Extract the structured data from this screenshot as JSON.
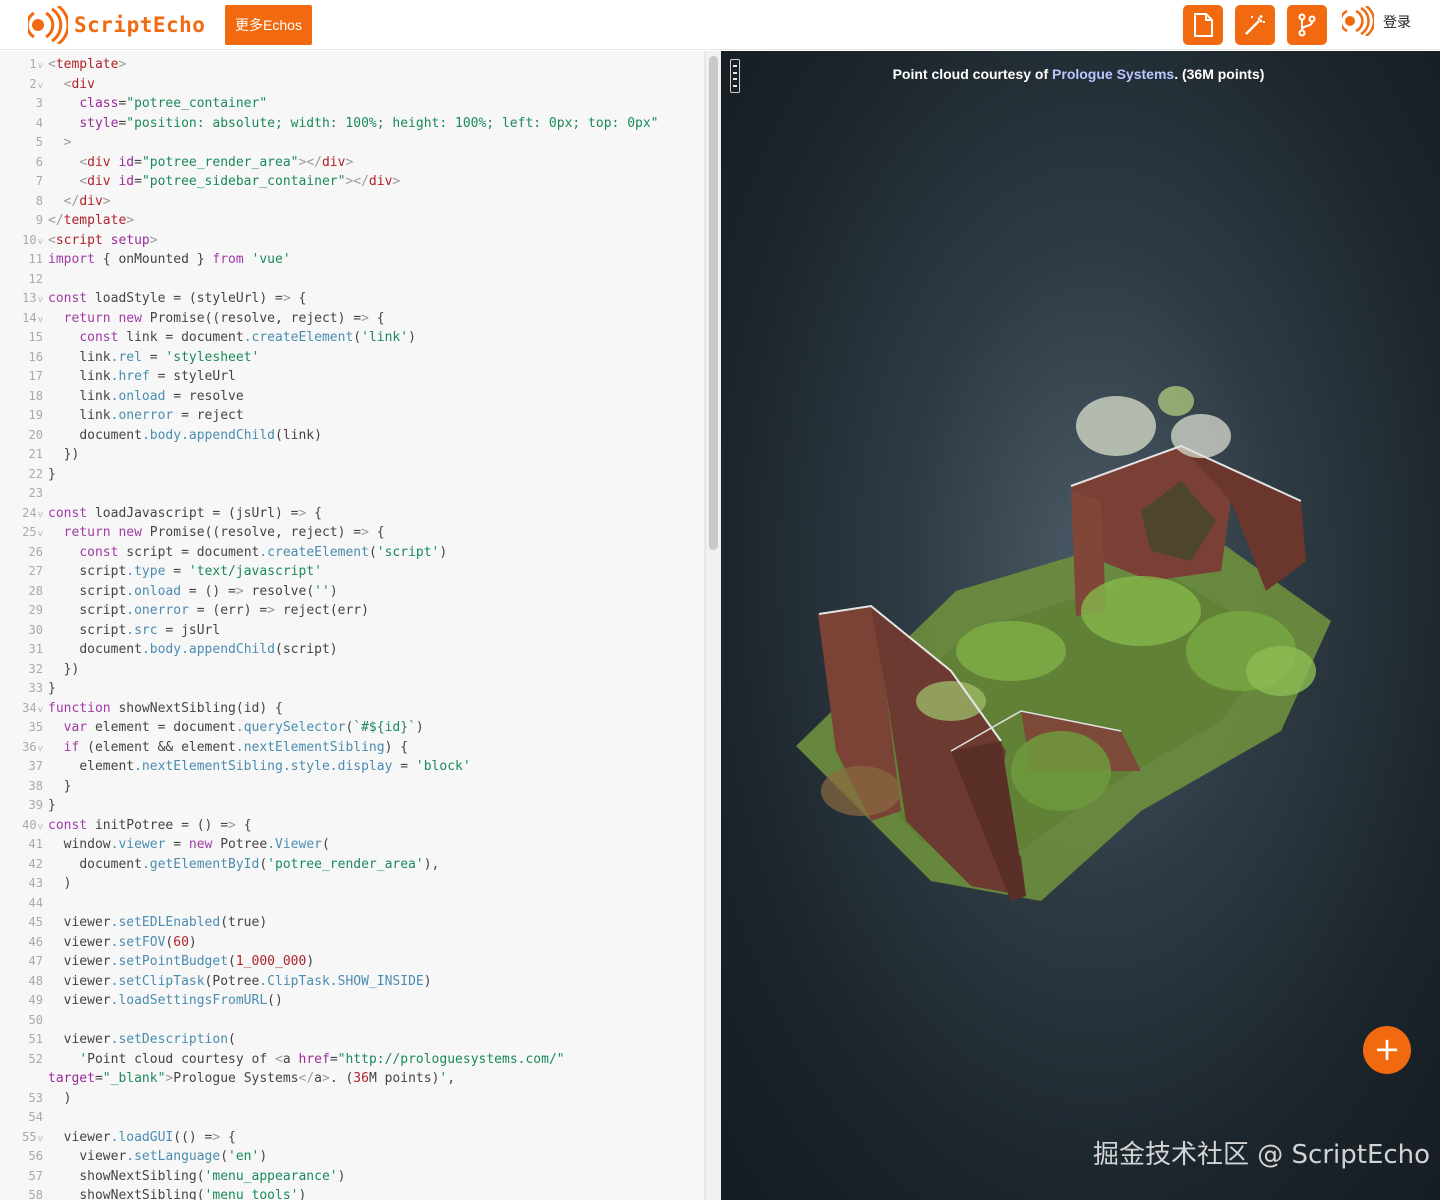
{
  "header": {
    "logo_text": "ScriptEcho",
    "more_button": "更多Echos",
    "login_label": "登录",
    "icons": [
      "file-icon",
      "magic-wand-icon",
      "fork-icon"
    ]
  },
  "colors": {
    "accent": "#f26a10",
    "viewer_bg": "#1f2a31",
    "link": "#b9c7ff"
  },
  "editor": {
    "lines": [
      {
        "n": "1",
        "fold": true,
        "text": "<template>"
      },
      {
        "n": "2",
        "fold": true,
        "text": "  <div"
      },
      {
        "n": "3",
        "fold": false,
        "text": "    class=\"potree_container\""
      },
      {
        "n": "4",
        "fold": false,
        "text": "    style=\"position: absolute; width: 100%; height: 100%; left: 0px; top: 0px\""
      },
      {
        "n": "5",
        "fold": false,
        "text": "  >"
      },
      {
        "n": "6",
        "fold": false,
        "text": "    <div id=\"potree_render_area\"></div>"
      },
      {
        "n": "7",
        "fold": false,
        "text": "    <div id=\"potree_sidebar_container\"></div>"
      },
      {
        "n": "8",
        "fold": false,
        "text": "  </div>"
      },
      {
        "n": "9",
        "fold": false,
        "text": "</template>"
      },
      {
        "n": "10",
        "fold": true,
        "text": "<script setup>"
      },
      {
        "n": "11",
        "fold": false,
        "text": "import { onMounted } from 'vue'"
      },
      {
        "n": "12",
        "fold": false,
        "text": ""
      },
      {
        "n": "13",
        "fold": true,
        "text": "const loadStyle = (styleUrl) => {"
      },
      {
        "n": "14",
        "fold": true,
        "text": "  return new Promise((resolve, reject) => {"
      },
      {
        "n": "15",
        "fold": false,
        "text": "    const link = document.createElement('link')"
      },
      {
        "n": "16",
        "fold": false,
        "text": "    link.rel = 'stylesheet'"
      },
      {
        "n": "17",
        "fold": false,
        "text": "    link.href = styleUrl"
      },
      {
        "n": "18",
        "fold": false,
        "text": "    link.onload = resolve"
      },
      {
        "n": "19",
        "fold": false,
        "text": "    link.onerror = reject"
      },
      {
        "n": "20",
        "fold": false,
        "text": "    document.body.appendChild(link)"
      },
      {
        "n": "21",
        "fold": false,
        "text": "  })"
      },
      {
        "n": "22",
        "fold": false,
        "text": "}"
      },
      {
        "n": "23",
        "fold": false,
        "text": ""
      },
      {
        "n": "24",
        "fold": true,
        "text": "const loadJavascript = (jsUrl) => {"
      },
      {
        "n": "25",
        "fold": true,
        "text": "  return new Promise((resolve, reject) => {"
      },
      {
        "n": "26",
        "fold": false,
        "text": "    const script = document.createElement('script')"
      },
      {
        "n": "27",
        "fold": false,
        "text": "    script.type = 'text/javascript'"
      },
      {
        "n": "28",
        "fold": false,
        "text": "    script.onload = () => resolve('')"
      },
      {
        "n": "29",
        "fold": false,
        "text": "    script.onerror = (err) => reject(err)"
      },
      {
        "n": "30",
        "fold": false,
        "text": "    script.src = jsUrl"
      },
      {
        "n": "31",
        "fold": false,
        "text": "    document.body.appendChild(script)"
      },
      {
        "n": "32",
        "fold": false,
        "text": "  })"
      },
      {
        "n": "33",
        "fold": false,
        "text": "}"
      },
      {
        "n": "34",
        "fold": true,
        "text": "function showNextSibling(id) {"
      },
      {
        "n": "35",
        "fold": false,
        "text": "  var element = document.querySelector(`#${id}`)"
      },
      {
        "n": "36",
        "fold": true,
        "text": "  if (element && element.nextElementSibling) {"
      },
      {
        "n": "37",
        "fold": false,
        "text": "    element.nextElementSibling.style.display = 'block'"
      },
      {
        "n": "38",
        "fold": false,
        "text": "  }"
      },
      {
        "n": "39",
        "fold": false,
        "text": "}"
      },
      {
        "n": "40",
        "fold": true,
        "text": "const initPotree = () => {"
      },
      {
        "n": "41",
        "fold": false,
        "text": "  window.viewer = new Potree.Viewer("
      },
      {
        "n": "42",
        "fold": false,
        "text": "    document.getElementById('potree_render_area'),"
      },
      {
        "n": "43",
        "fold": false,
        "text": "  )"
      },
      {
        "n": "44",
        "fold": false,
        "text": ""
      },
      {
        "n": "45",
        "fold": false,
        "text": "  viewer.setEDLEnabled(true)"
      },
      {
        "n": "46",
        "fold": false,
        "text": "  viewer.setFOV(60)"
      },
      {
        "n": "47",
        "fold": false,
        "text": "  viewer.setPointBudget(1_000_000)"
      },
      {
        "n": "48",
        "fold": false,
        "text": "  viewer.setClipTask(Potree.ClipTask.SHOW_INSIDE)"
      },
      {
        "n": "49",
        "fold": false,
        "text": "  viewer.loadSettingsFromURL()"
      },
      {
        "n": "50",
        "fold": false,
        "text": ""
      },
      {
        "n": "51",
        "fold": false,
        "text": "  viewer.setDescription("
      },
      {
        "n": "52",
        "fold": false,
        "text": "    'Point cloud courtesy of <a href=\"http://prologuesystems.com/\""
      },
      {
        "n": "",
        "fold": false,
        "text": "target=\"_blank\">Prologue Systems</a>. (36M points)',"
      },
      {
        "n": "53",
        "fold": false,
        "text": "  )"
      },
      {
        "n": "54",
        "fold": false,
        "text": ""
      },
      {
        "n": "55",
        "fold": true,
        "text": "  viewer.loadGUI(() => {"
      },
      {
        "n": "56",
        "fold": false,
        "text": "    viewer.setLanguage('en')"
      },
      {
        "n": "57",
        "fold": false,
        "text": "    showNextSibling('menu_appearance')"
      },
      {
        "n": "58",
        "fold": false,
        "text": "    showNextSibling('menu_tools')"
      }
    ]
  },
  "viewer": {
    "description_prefix": "Point cloud courtesy of ",
    "description_link": "Prologue Systems",
    "description_suffix": ". (36M points)",
    "fab_label": "+",
    "watermark": "掘金技术社区 @ ScriptEcho"
  }
}
